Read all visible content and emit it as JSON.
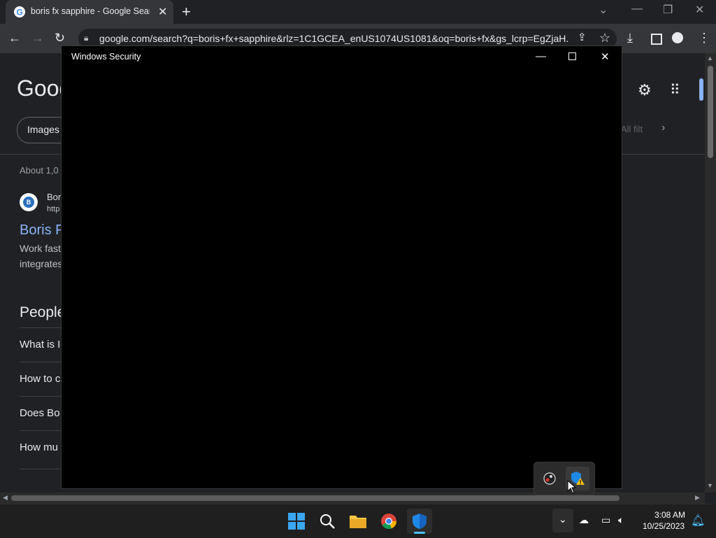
{
  "browser": {
    "tab_title": "boris fx sapphire - Google Search",
    "url": "google.com/search?q=boris+fx+sapphire&rlz=1C1GCEA_enUS1074US1081&oq=boris+fx&gs_lcrp=EgZjaH..."
  },
  "google": {
    "logo_partial": "Goog",
    "chip_images": "Images",
    "all_filters": "All filt",
    "about": "About 1,0",
    "result_site": "Bor",
    "result_url": "http",
    "result_title": "Boris F",
    "snippet_line1": "Work fast",
    "snippet_line2": "integrates",
    "paa_heading": "People",
    "questions": [
      "What is I",
      "How to c",
      "Does Bo",
      "How mu"
    ]
  },
  "security_window": {
    "title": "Windows Security"
  },
  "taskbar": {
    "time": "3:08 AM",
    "date": "10/25/2023"
  }
}
